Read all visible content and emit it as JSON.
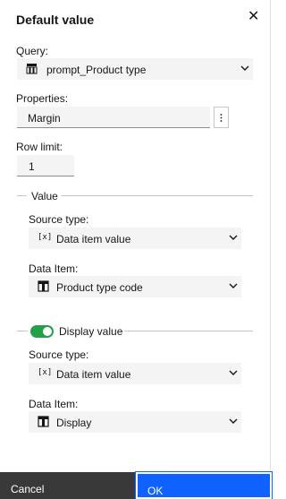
{
  "dialog": {
    "title": "Default value",
    "close_icon": "close-icon"
  },
  "query": {
    "label": "Query:",
    "value": "prompt_Product type",
    "icon": "table-icon"
  },
  "properties": {
    "label": "Properties:",
    "value": "Margin",
    "more_icon": "vertical-dots-icon"
  },
  "row_limit": {
    "label": "Row limit:",
    "value": "1"
  },
  "value_section": {
    "title": "Value",
    "source_type_label": "Source type:",
    "source_type_value": "Data item value",
    "source_type_icon": "[x]",
    "data_item_label": "Data Item:",
    "data_item_value": "Product type code",
    "data_item_icon": "column-icon"
  },
  "display_section": {
    "toggle_on": true,
    "title": "Display value",
    "source_type_label": "Source type:",
    "source_type_value": "Data item value",
    "source_type_icon": "[x]",
    "data_item_label": "Data Item:",
    "data_item_value": "Display",
    "data_item_icon": "column-icon"
  },
  "footer": {
    "cancel_label": "Cancel",
    "ok_label": "OK"
  },
  "colors": {
    "toggle": "#24a148",
    "ok_button": "#0f62fe",
    "cancel_button": "#393939"
  }
}
